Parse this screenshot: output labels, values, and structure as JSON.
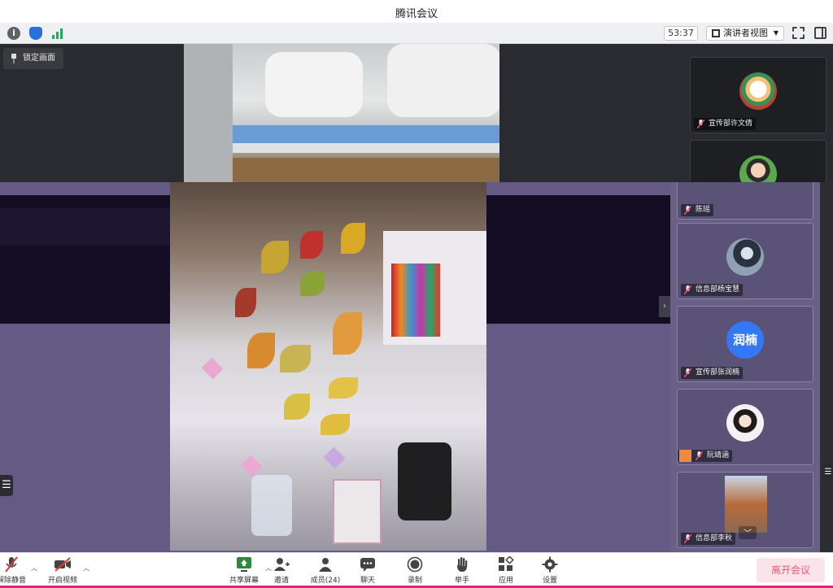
{
  "window": {
    "title": "腾讯会议"
  },
  "infobar": {
    "timer": "53:37",
    "view_mode": "演讲者视图",
    "icons": [
      "info-icon",
      "shield-icon",
      "signal-icon",
      "fullscreen-icon",
      "sidebar-toggle-icon"
    ]
  },
  "stage": {
    "lock_screen_label": "锁定画面"
  },
  "participants": [
    {
      "name": "宣传部许文倩",
      "avatar": "photo"
    },
    {
      "name": "陈瑶",
      "avatar": "photo"
    },
    {
      "name": "信息部杨宝慧",
      "avatar": "photo"
    },
    {
      "name": "宣传部张润楠",
      "avatar": "text",
      "avatar_text": "润楠"
    },
    {
      "name": "阮靖涵",
      "avatar": "photo"
    },
    {
      "name": "信息部李秋",
      "avatar": "video"
    }
  ],
  "toolbar": {
    "items": [
      {
        "label": "解除静音",
        "icon": "mic-muted-icon"
      },
      {
        "label": "开启视频",
        "icon": "camera-off-icon"
      },
      {
        "label": "共享屏幕",
        "icon": "share-screen-icon"
      },
      {
        "label": "邀请",
        "icon": "invite-icon"
      },
      {
        "label": "成员(24)",
        "icon": "members-icon"
      },
      {
        "label": "聊天",
        "icon": "chat-icon"
      },
      {
        "label": "录制",
        "icon": "record-icon"
      },
      {
        "label": "举手",
        "icon": "raise-hand-icon"
      },
      {
        "label": "应用",
        "icon": "apps-icon"
      },
      {
        "label": "设置",
        "icon": "settings-icon"
      }
    ],
    "leave_label": "离开会议"
  },
  "colors": {
    "accent_blue": "#3478f6",
    "leave_pink": "#e45a7c",
    "stage_purple": "#645a84"
  }
}
